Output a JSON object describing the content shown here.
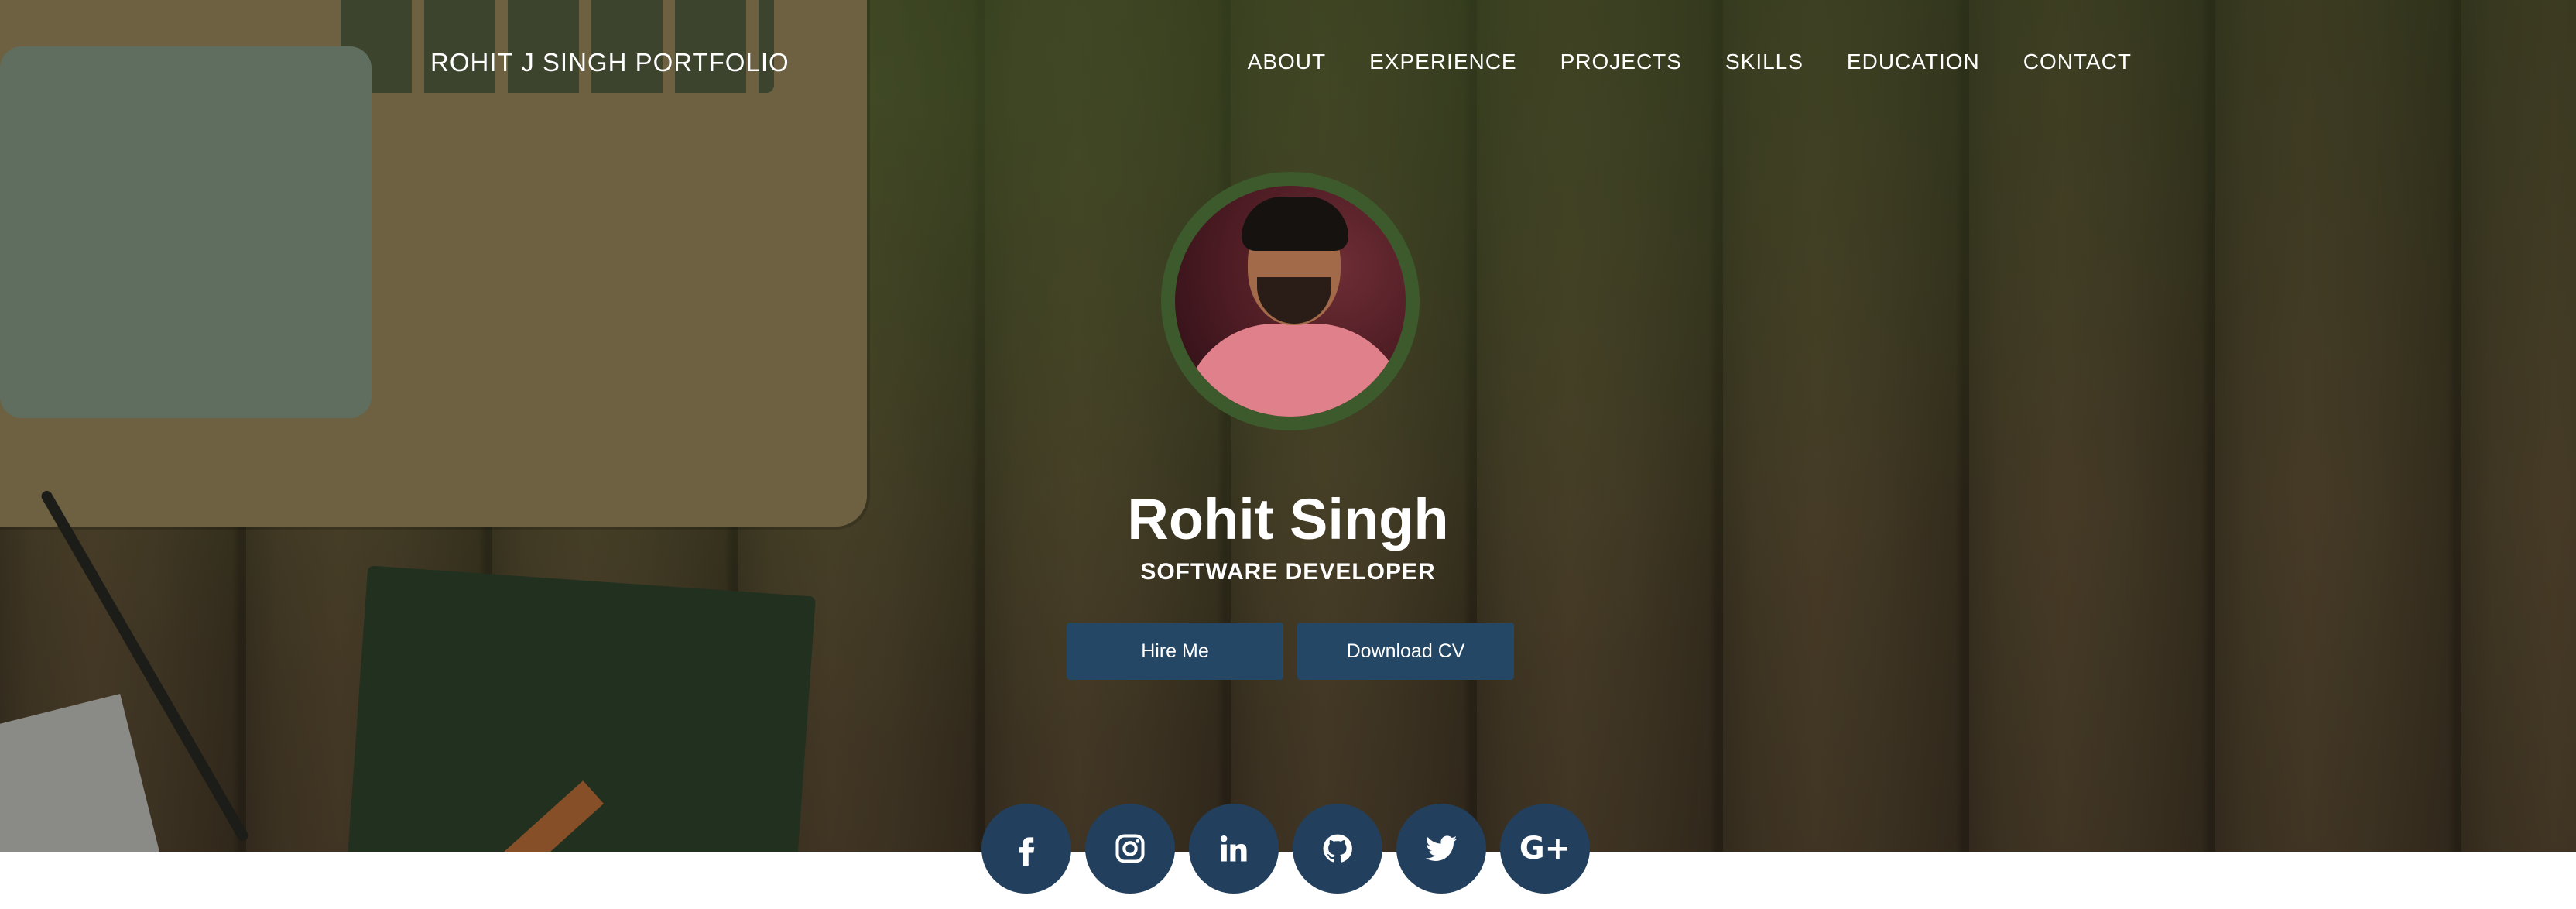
{
  "header": {
    "brand": "ROHIT J SINGH PORTFOLIO",
    "nav": [
      {
        "label": "ABOUT"
      },
      {
        "label": "EXPERIENCE"
      },
      {
        "label": "PROJECTS"
      },
      {
        "label": "SKILLS"
      },
      {
        "label": "EDUCATION"
      },
      {
        "label": "CONTACT"
      }
    ]
  },
  "profile": {
    "name": "Rohit Singh",
    "role": "SOFTWARE DEVELOPER",
    "hire_label": "Hire Me",
    "cv_label": "Download CV"
  },
  "social": [
    {
      "icon": "facebook-icon"
    },
    {
      "icon": "instagram-icon"
    },
    {
      "icon": "linkedin-icon"
    },
    {
      "icon": "github-icon"
    },
    {
      "icon": "twitter-icon"
    },
    {
      "icon": "google-plus-icon",
      "glyph": "G+"
    }
  ],
  "colors": {
    "button": "#244766",
    "social": "#22405d",
    "avatar_ring": "#3c5a2c"
  }
}
